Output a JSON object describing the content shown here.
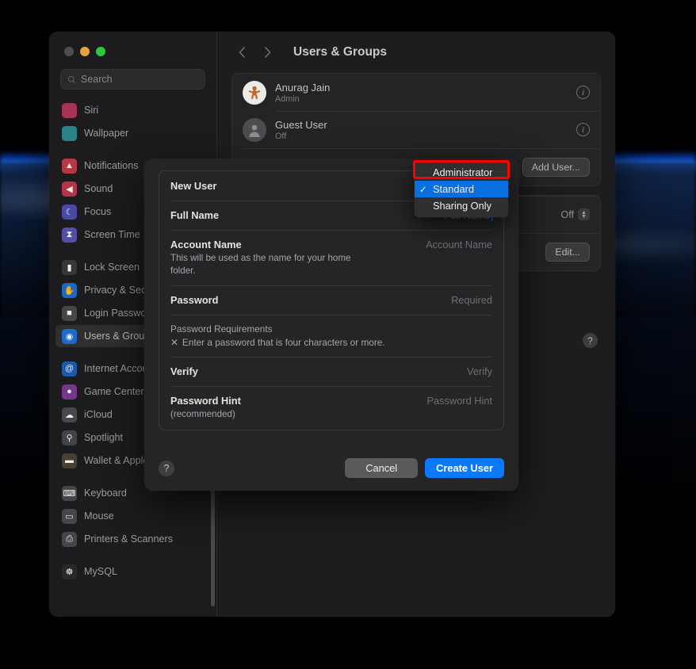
{
  "window": {
    "traffic_lights": [
      "close",
      "minimize",
      "zoom"
    ],
    "search": {
      "placeholder": "Search",
      "icon": "search-icon"
    }
  },
  "sidebar": {
    "groups": [
      {
        "items": [
          {
            "label": "Siri",
            "icon": "siri-icon",
            "color": "#b3355b",
            "glyph": ""
          },
          {
            "label": "Wallpaper",
            "icon": "wallpaper-icon",
            "color": "#2b8a93",
            "glyph": ""
          }
        ]
      },
      {
        "items": [
          {
            "label": "Notifications",
            "icon": "notifications-icon",
            "color": "#c33b46",
            "glyph": "▲"
          },
          {
            "label": "Sound",
            "icon": "sound-icon",
            "color": "#c0394a",
            "glyph": "◀"
          },
          {
            "label": "Focus",
            "icon": "focus-icon",
            "color": "#4b4fb0",
            "glyph": "☾"
          },
          {
            "label": "Screen Time",
            "icon": "screen-time-icon",
            "color": "#5a53b5",
            "glyph": "⧗"
          }
        ]
      },
      {
        "items": [
          {
            "label": "Lock Screen",
            "icon": "lock-screen-icon",
            "color": "#3a3a3d",
            "glyph": "▮"
          },
          {
            "label": "Privacy & Security",
            "icon": "privacy-security-icon",
            "color": "#1c6fd0",
            "glyph": "✋"
          },
          {
            "label": "Login Password",
            "icon": "login-password-icon",
            "color": "#4a4a4d",
            "glyph": "■"
          },
          {
            "label": "Users & Groups",
            "icon": "users-groups-icon",
            "color": "#1d6fd6",
            "glyph": "◉",
            "selected": true
          }
        ]
      },
      {
        "items": [
          {
            "label": "Internet Accounts",
            "icon": "internet-accounts-icon",
            "color": "#1f5fb5",
            "glyph": "@"
          },
          {
            "label": "Game Center",
            "icon": "game-center-icon",
            "color": "#7c3a95",
            "glyph": "●"
          },
          {
            "label": "iCloud",
            "icon": "icloud-icon",
            "color": "#4c4c50",
            "glyph": "☁"
          },
          {
            "label": "Spotlight",
            "icon": "spotlight-icon",
            "color": "#48484c",
            "glyph": "⚲"
          },
          {
            "label": "Wallet & Apple Pay",
            "icon": "wallet-apple-pay-icon",
            "color": "#4a4438",
            "glyph": "▬"
          }
        ]
      },
      {
        "items": [
          {
            "label": "Keyboard",
            "icon": "keyboard-icon",
            "color": "#4a4a4e",
            "glyph": "⌨"
          },
          {
            "label": "Mouse",
            "icon": "mouse-icon",
            "color": "#4a4a4e",
            "glyph": "▭"
          },
          {
            "label": "Printers & Scanners",
            "icon": "printers-scanners-icon",
            "color": "#4a4a4e",
            "glyph": "⎙"
          }
        ]
      },
      {
        "items": [
          {
            "label": "MySQL",
            "icon": "mysql-icon",
            "color": "#2b2b2e",
            "glyph": "☸"
          }
        ]
      }
    ]
  },
  "toolbar": {
    "back_icon": "chevron-left-icon",
    "forward_icon": "chevron-right-icon",
    "title": "Users & Groups"
  },
  "users": [
    {
      "name": "Anurag Jain",
      "status": "Admin",
      "avatar": "gingerbread-avatar",
      "info_icon": "info-icon"
    },
    {
      "name": "Guest User",
      "status": "Off",
      "avatar": "person-placeholder-avatar",
      "info_icon": "info-icon"
    }
  ],
  "main_actions": {
    "add_user_label": "Add User...",
    "auto_login_value": "Off",
    "edit_label": "Edit...",
    "help_label": "?"
  },
  "sheet": {
    "fields": [
      {
        "label": "New User",
        "value": "",
        "kind": "popup-trigger"
      },
      {
        "label": "Full Name",
        "value": "Full Name",
        "kind": "text",
        "focused": true
      },
      {
        "label": "Account Name",
        "sub": "This will be used as the name for your home folder.",
        "value": "Account Name",
        "kind": "text"
      },
      {
        "label": "Password",
        "value": "Required",
        "kind": "password"
      }
    ],
    "requirements": {
      "title": "Password Requirements",
      "marker": "✕",
      "text": "Enter a password that is four characters or more."
    },
    "fields_after": [
      {
        "label": "Verify",
        "value": "Verify",
        "kind": "password"
      },
      {
        "label": "Password Hint",
        "sub": "(recommended)",
        "value": "Password Hint",
        "kind": "text"
      }
    ],
    "help_label": "?",
    "cancel_label": "Cancel",
    "create_label": "Create User"
  },
  "popup_menu": {
    "items": [
      {
        "label": "Administrator",
        "checked": false,
        "highlighted_by_annotation": true
      },
      {
        "label": "Standard",
        "checked": true,
        "check_glyph": "✓"
      },
      {
        "label": "Sharing Only",
        "checked": false
      }
    ]
  },
  "annotation": {
    "color": "#fe0000",
    "target": "Administrator"
  }
}
